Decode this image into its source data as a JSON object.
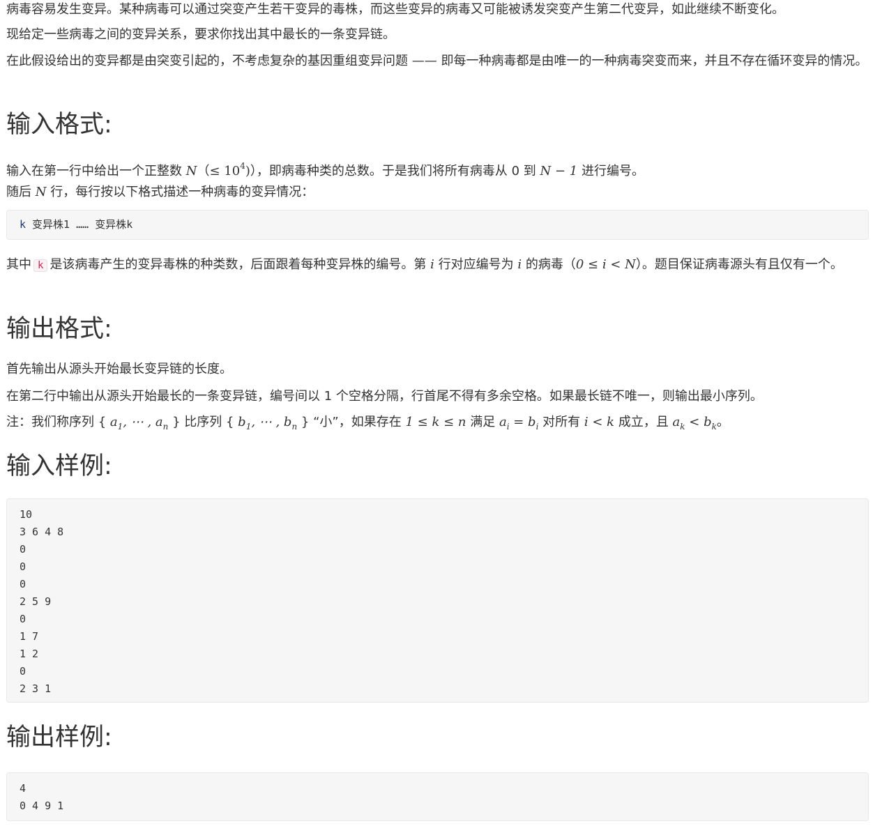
{
  "intro": {
    "p1": "病毒容易发生变异。某种病毒可以通过突变产生若干变异的毒株，而这些变异的病毒又可能被诱发突变产生第二代变异，如此继续不断变化。",
    "p2": "现给定一些病毒之间的变异关系，要求你找出其中最长的一条变异链。",
    "p3": "在此假设给出的变异都是由突变引起的，不考虑复杂的基因重组变异问题 —— 即每一种病毒都是由唯一的一种病毒突变而来，并且不存在循环变异的情况。"
  },
  "input_section": {
    "heading": "输入格式:",
    "line1_a": "输入在第一行中给出一个正整数 ",
    "line1_n": "N",
    "line1_b": "（",
    "line1_le": "≤ 10",
    "line1_exp": "4",
    "line1_close": ")",
    "line1_c": "），即病毒种类的总数。于是我们将所有病毒从 0 到 ",
    "line1_nminus": "N − 1",
    "line1_d": " 进行编号。",
    "line2_a": "随后 ",
    "line2_n": "N",
    "line2_b": " 行，每行按以下格式描述一种病毒的变异情况：",
    "format_k": "k",
    "format_rest": " 变异株1 …… 变异株k",
    "line3_a": "其中",
    "line3_code": "k",
    "line3_b": "是该病毒产生的变异毒株的种类数，后面跟着每种变异株的编号。第 ",
    "line3_i": "i",
    "line3_c": " 行对应编号为 ",
    "line3_i2": "i",
    "line3_d": " 的病毒（",
    "line3_range": "0 ≤ i < N",
    "line3_e": "）。题目保证病毒源头有且仅有一个。"
  },
  "output_section": {
    "heading": "输出格式:",
    "line1": "首先输出从源头开始最长变异链的长度。",
    "line2": "在第二行中输出从源头开始最长的一条变异链，编号间以 1 个空格分隔，行首尾不得有多余空格。如果最长链不唯一，则输出最小序列。",
    "note_a": "注：我们称序列 { ",
    "note_seq_a": "a",
    "note_sub1": "1",
    "note_mid_a": ", ⋯ , a",
    "note_subn": "n",
    "note_b": " } 比序列 { ",
    "note_seq_b": "b",
    "note_sub1b": "1",
    "note_mid_b": ", ⋯ , b",
    "note_subnb": "n",
    "note_c": " } “小”，如果存在 ",
    "note_cond": "1 ≤ k ≤ n",
    "note_d": " 满足 ",
    "note_ai": "a",
    "note_ai_sub": "i",
    "note_eq": " = b",
    "note_bi_sub": "i",
    "note_e": " 对所有 ",
    "note_ilk": "i < k",
    "note_f": " 成立，且 ",
    "note_ak": "a",
    "note_ak_sub": "k",
    "note_lt": " < b",
    "note_bk_sub": "k",
    "note_g": "。"
  },
  "sample_input": {
    "heading": "输入样例:",
    "lines": [
      "10",
      "3 6 4 8",
      "0",
      "0",
      "0",
      "2 5 9",
      "0",
      "1 7",
      "1 2",
      "0",
      "2 3 1"
    ]
  },
  "sample_output": {
    "heading": "输出样例:",
    "lines": [
      "4",
      "0 4 9 1"
    ]
  }
}
